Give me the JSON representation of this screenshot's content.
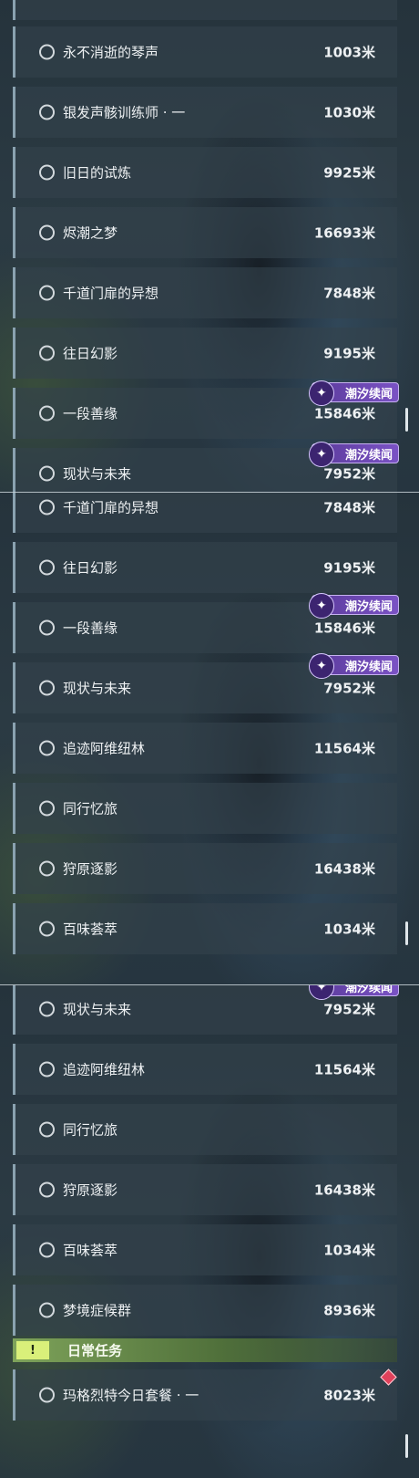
{
  "badge_label": "潮汐续闻",
  "badge_icon": "wave-emblem-icon",
  "colors": {
    "row_bg": "#34424c",
    "row_accent": "#8aa2b0",
    "badge": "#6a47b2",
    "daily_header": "#7ea35a",
    "marker": "#e0415b"
  },
  "panel1": {
    "rows": [
      {
        "title": "永不消逝的琴声",
        "distance": "1003米"
      },
      {
        "title": "银发声骸训练师 · 一",
        "distance": "1030米"
      },
      {
        "title": "旧日的试炼",
        "distance": "9925米"
      },
      {
        "title": "烬潮之梦",
        "distance": "16693米"
      },
      {
        "title": "千道门扉的异想",
        "distance": "7848米"
      },
      {
        "title": "往日幻影",
        "distance": "9195米"
      },
      {
        "title": "一段善缘",
        "distance": "15846米"
      },
      {
        "title": "现状与未来",
        "distance": "7952米"
      }
    ]
  },
  "panel2": {
    "rows": [
      {
        "title": "千道门扉的异想",
        "distance": "7848米"
      },
      {
        "title": "往日幻影",
        "distance": "9195米"
      },
      {
        "title": "一段善缘",
        "distance": "15846米"
      },
      {
        "title": "现状与未来",
        "distance": "7952米"
      },
      {
        "title": "追迹阿维纽林",
        "distance": "11564米"
      },
      {
        "title": "同行忆旅",
        "distance": ""
      },
      {
        "title": "狩原逐影",
        "distance": "16438米"
      },
      {
        "title": "百味荟萃",
        "distance": "1034米"
      }
    ]
  },
  "panel3": {
    "rows": [
      {
        "title": "现状与未来",
        "distance": "7952米"
      },
      {
        "title": "追迹阿维纽林",
        "distance": "11564米"
      },
      {
        "title": "同行忆旅",
        "distance": ""
      },
      {
        "title": "狩原逐影",
        "distance": "16438米"
      },
      {
        "title": "百味荟萃",
        "distance": "1034米"
      },
      {
        "title": "梦境症候群",
        "distance": "8936米"
      }
    ],
    "daily_section": {
      "title": "日常任务",
      "icon": "!",
      "rows": [
        {
          "title": "玛格烈特今日套餐 · 一",
          "distance": "8023米"
        }
      ]
    }
  }
}
